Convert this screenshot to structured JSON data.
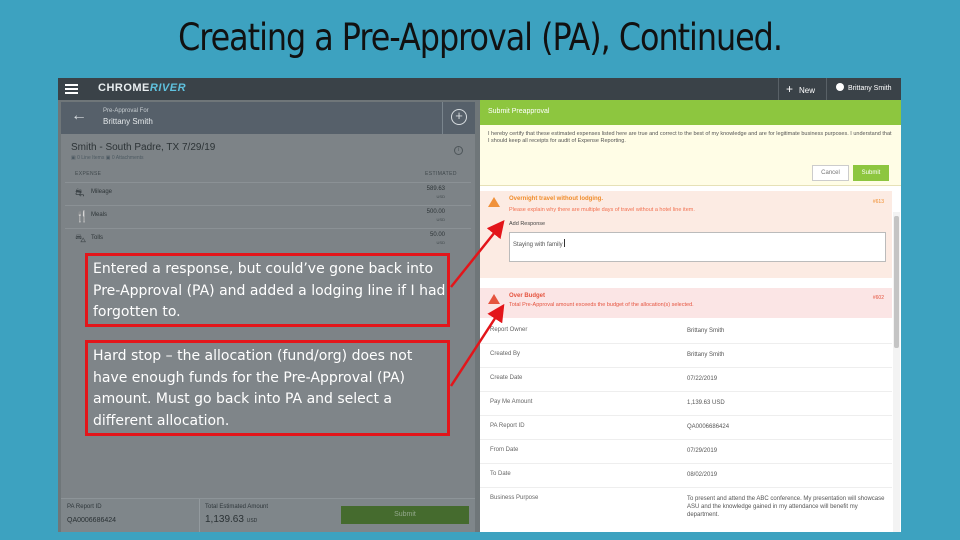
{
  "slide": {
    "title": "Creating a Pre-Approval (PA), Continued."
  },
  "topbar": {
    "logo_main": "CHROME",
    "logo_accent": "RIVER",
    "new_label": "New",
    "user_name": "Brittany Smith"
  },
  "left_panel": {
    "pa_for_label": "Pre-Approval For",
    "pa_for_name": "Brittany Smith",
    "report_title": "Smith - South Padre, TX 7/29/19",
    "report_meta": "▣ 0 Line Items   ▣ 0 Attachments",
    "col_expense": "EXPENSE",
    "col_estimated": "ESTIMATED",
    "expenses": [
      {
        "label": "Mileage",
        "amount": "589.63",
        "currency": "USD",
        "icon": "car-icon"
      },
      {
        "label": "Meals",
        "amount": "500.00",
        "currency": "USD",
        "icon": "fork-knife-icon"
      },
      {
        "label": "Tolls",
        "amount": "50.00",
        "currency": "USD",
        "icon": "toll-icon"
      }
    ],
    "footer": {
      "pa_report_id_label": "PA Report ID",
      "pa_report_id": "QA0006686424",
      "total_label": "Total Estimated Amount",
      "total_value": "1,139.63",
      "total_currency": "USD",
      "submit_label": "Submit"
    }
  },
  "right_panel": {
    "header": "Submit Preapproval",
    "confirm_text": "I hereby certify that these estimated expenses listed here are true and correct to the best of my knowledge and are for legitimate business purposes. I understand that I should keep all receipts for audit of Expense Reporting.",
    "cancel_label": "Cancel",
    "submit_label": "Submit",
    "warning": {
      "title": "Overnight travel without lodging.",
      "message": "Please explain why there are multiple days of travel without a hotel line item.",
      "code": "#613",
      "response_label": "Add Response",
      "response_value": "Staying with family"
    },
    "over_budget": {
      "title": "Over Budget",
      "message": "Total Pre-Approval amount exceeds the budget of the allocation(s) selected.",
      "code": "#602"
    },
    "info_rows": [
      {
        "label": "Report Owner",
        "value": "Brittany Smith"
      },
      {
        "label": "Created By",
        "value": "Brittany Smith"
      },
      {
        "label": "Create Date",
        "value": "07/22/2019"
      },
      {
        "label": "Pay Me Amount",
        "value": "1,139.63 USD"
      },
      {
        "label": "PA Report ID",
        "value": "QA0006686424"
      },
      {
        "label": "From Date",
        "value": "07/29/2019"
      },
      {
        "label": "To Date",
        "value": "08/02/2019"
      },
      {
        "label": "Business Purpose",
        "value": "To present and attend the ABC conference. My presentation will showcase ASU and the knowledge gained in my attendance will benefit my department."
      }
    ]
  },
  "callouts": [
    {
      "text": "Entered a response, but could’ve gone back into Pre-Approval (PA) and added a lodging line if I had forgotten to."
    },
    {
      "text": "Hard stop – the allocation (fund/org) does not have enough funds for the Pre-Approval (PA) amount. Must go back into PA and select a different allocation."
    }
  ],
  "colors": {
    "slide_bg": "#3da2c0",
    "callout_border": "#e3151a",
    "accent_green": "#8dc63f"
  }
}
